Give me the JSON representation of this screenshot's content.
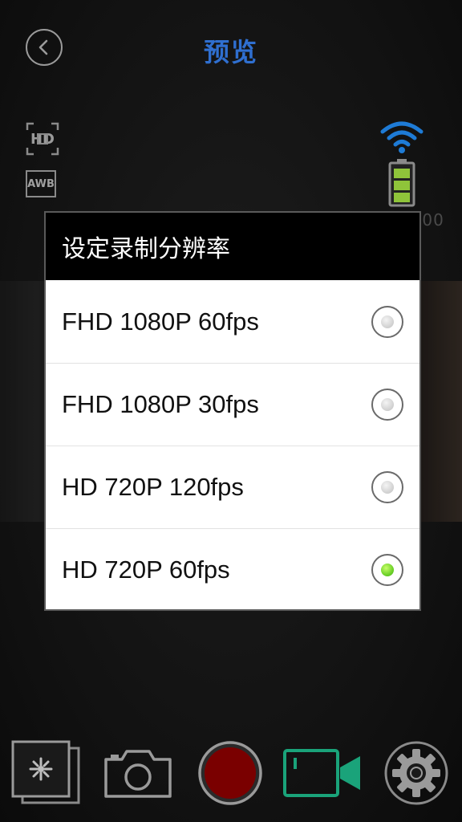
{
  "header": {
    "title": "预览",
    "back_icon": "chevron-left-icon"
  },
  "status": {
    "hd_label": "HD",
    "awb_label": "AWB",
    "timer": "00:00:00",
    "wifi_color": "#1e7bd6",
    "battery_color": "#8fc43a"
  },
  "dialog": {
    "title": "设定录制分辨率",
    "options": [
      {
        "label": "FHD 1080P 60fps",
        "selected": false
      },
      {
        "label": "FHD 1080P 30fps",
        "selected": false
      },
      {
        "label": "HD 720P 120fps",
        "selected": false
      },
      {
        "label": "HD 720P 60fps",
        "selected": true
      }
    ]
  },
  "toolbar": {
    "gallery_icon": "gallery-icon",
    "photo_icon": "camera-icon",
    "record_icon": "record-icon",
    "video_icon": "video-camera-icon",
    "settings_icon": "gear-icon",
    "record_color": "#7a0000",
    "video_color": "#1aa37a"
  }
}
